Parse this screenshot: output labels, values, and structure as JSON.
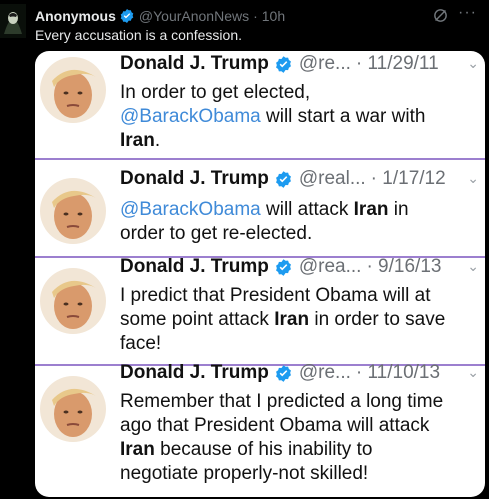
{
  "post": {
    "author_name": "Anonymous",
    "author_handle": "@YourAnonNews",
    "dot": "·",
    "time": "10h",
    "text": "Every accusation is a confession.",
    "more_glyph": "···"
  },
  "tweets": [
    {
      "name": "Donald J. Trump",
      "handle": "@re...",
      "date": "· 11/29/11",
      "chevron": "⌄",
      "p1": "In order to get elected,",
      "mention": "@BarackObama",
      "p2": " will start a war with",
      "kw": "Iran",
      "p3": "."
    },
    {
      "name": "Donald J. Trump",
      "handle": "@real...",
      "date": "· 1/17/12",
      "chevron": "⌄",
      "mention": "@BarackObama",
      "p1": " will attack ",
      "kw": "Iran",
      "p2": " in",
      "p3": "order to get re-elected."
    },
    {
      "name": "Donald J. Trump",
      "handle": "@rea...",
      "date": "· 9/16/13",
      "chevron": "⌄",
      "p1": "I predict that President Obama will at",
      "p2": "some point attack ",
      "kw": "Iran",
      "p3": " in order to save",
      "p4": "face!"
    },
    {
      "name": "Donald J. Trump",
      "handle": "@re...",
      "date": "· 11/10/13",
      "chevron": "⌄",
      "p1": "Remember that I predicted a long time",
      "p2": "ago that President Obama will attack",
      "kw": "Iran",
      "p3": " because of his inability to",
      "p4": "negotiate properly-not skilled!"
    }
  ],
  "colors": {
    "verified": "#1d9bf0",
    "mention": "#3f8ad8",
    "separator": "#9c7fcf"
  }
}
